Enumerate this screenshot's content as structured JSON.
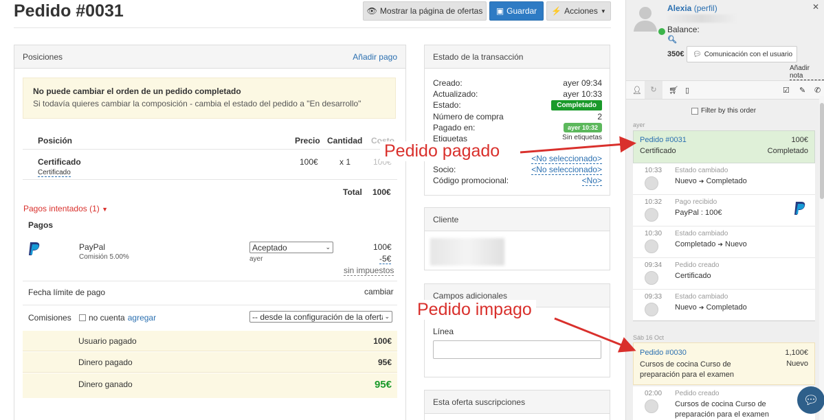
{
  "header": {
    "title": "Pedido #0031",
    "btn_show": "Mostrar la página de ofertas",
    "btn_save": "Guardar",
    "btn_actions": "Acciones"
  },
  "positions": {
    "title": "Posiciones",
    "add_payment": "Añadir pago",
    "warning_title": "No puede cambiar el orden de un pedido completado",
    "warning_text": "Si todavía quieres cambiar la composición - cambia el estado del pedido a \"En desarrollo\"",
    "columns": {
      "position": "Posición",
      "price": "Precio",
      "qty": "Cantidad",
      "cost": "Costo"
    },
    "item": {
      "name": "Certificado",
      "sub": "Certificado",
      "price": "100€",
      "qty": "x 1",
      "cost": "100€"
    },
    "total_label": "Total",
    "total_value": "100€",
    "attempted": "Pagos intentados (1)",
    "payments_title": "Pagos",
    "payment": {
      "method": "PayPal",
      "commission": "Comisión 5.00%",
      "status": "Aceptado",
      "when": "ayer",
      "amount": "100€",
      "fee": "-5€",
      "tax": "sin impuestos"
    },
    "deadline_label": "Fecha límite de pago",
    "deadline_action": "cambiar",
    "commissions_label": "Comisiones",
    "no_account": "no cuenta",
    "add": "agregar",
    "commission_select": "-- desde la configuración de la oferta --",
    "summary": [
      {
        "label": "Usuario pagado",
        "value": "100€"
      },
      {
        "label": "Dinero pagado",
        "value": "95€"
      },
      {
        "label": "Dinero ganado",
        "value": "95€"
      }
    ]
  },
  "transaction": {
    "title": "Estado de la transacción",
    "created_label": "Creado:",
    "created": "ayer 09:34",
    "updated_label": "Actualizado:",
    "updated": "ayer 10:33",
    "status_label": "Estado:",
    "status": "Completado",
    "purchase_label": "Número de compra",
    "purchase": "2",
    "paid_label": "Pagado en:",
    "paid": "ayer 10:32",
    "tags_label": "Etiquetas",
    "tags": "Sin etiquetas",
    "row6_value": "<No seleccionado>",
    "partner_label": "Socio:",
    "partner": "<No seleccionado>",
    "promo_label": "Código promocional:",
    "promo": "<No>"
  },
  "client": {
    "title": "Cliente"
  },
  "extra": {
    "title": "Campos adicionales",
    "line_label": "Línea"
  },
  "subscriptions": {
    "title": "Esta oferta suscripciones"
  },
  "annotations": {
    "paid": "Pedido pagado",
    "unpaid": "Pedido impago"
  },
  "sidebar": {
    "user_name": "Alexia",
    "profile": "(perfil)",
    "balance_label": "Balance:",
    "amount": "350€",
    "contact_btn": "Comunicación con el usuario",
    "add_note": "Añadir nota",
    "filter_label": "Filter by this order",
    "day1": "ayer",
    "order1": {
      "id": "Pedido #0031",
      "amount": "100€",
      "product": "Certificado",
      "status": "Completado"
    },
    "events": [
      {
        "time": "10:33",
        "title": "Estado cambiado",
        "desc_a": "Nuevo",
        "desc_b": "Completado"
      },
      {
        "time": "10:32",
        "title": "Pago recibido",
        "desc": "PayPal : 100€"
      },
      {
        "time": "10:30",
        "title": "Estado cambiado",
        "desc_a": "Completado",
        "desc_b": "Nuevo"
      },
      {
        "time": "09:34",
        "title": "Pedido creado",
        "desc": "Certificado"
      },
      {
        "time": "09:33",
        "title": "Estado cambiado",
        "desc_a": "Nuevo",
        "desc_b": "Completado"
      }
    ],
    "day2": "Sáb 16 Oct",
    "order2": {
      "id": "Pedido #0030",
      "amount": "1,100€",
      "product": "Cursos de cocina Curso de preparación para el examen",
      "status": "Nuevo"
    },
    "event_last": {
      "time": "02:00",
      "title": "Pedido creado",
      "desc": "Cursos de cocina Curso de preparación para el examen"
    }
  },
  "colors": {
    "blue": "#2e7bc4",
    "green": "#1a9a2a",
    "warn_bg": "#fcf8e3",
    "red": "#d9302c"
  }
}
